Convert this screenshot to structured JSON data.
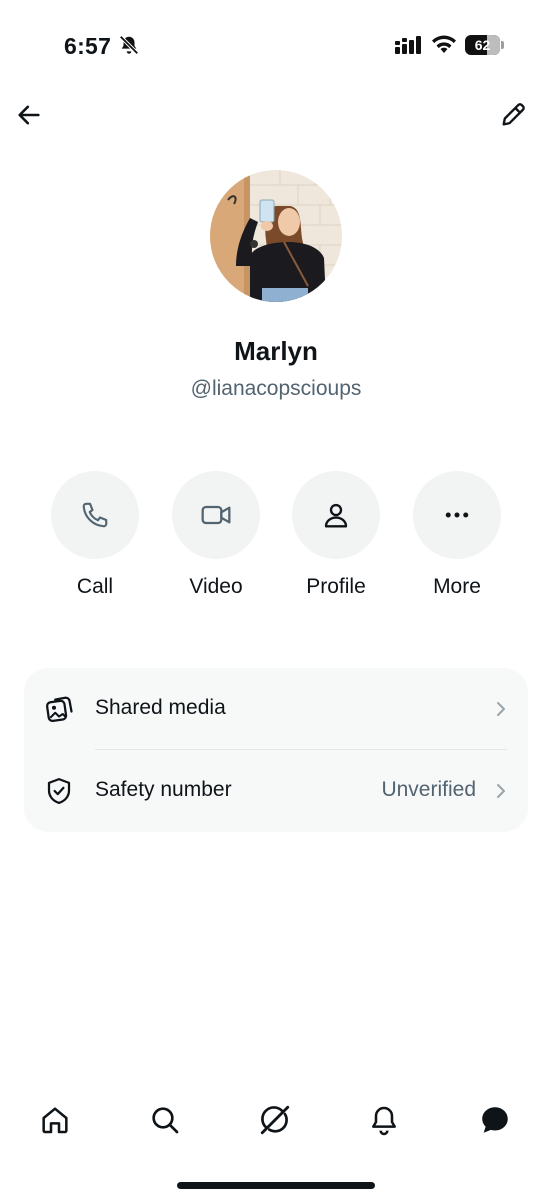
{
  "status_bar": {
    "time": "6:57",
    "battery_percent": "62",
    "battery_level": 0.62,
    "icons": [
      "bell-slash-icon",
      "signal-icon",
      "wifi-icon",
      "battery-icon"
    ]
  },
  "header": {
    "back_icon": "arrow-left-icon",
    "edit_icon": "pencil-icon"
  },
  "profile": {
    "display_name": "Marlyn",
    "handle": "@lianacopscioups"
  },
  "actions": [
    {
      "label": "Call",
      "icon": "phone-icon"
    },
    {
      "label": "Video",
      "icon": "video-camera-icon"
    },
    {
      "label": "Profile",
      "icon": "person-icon"
    },
    {
      "label": "More",
      "icon": "ellipsis-icon"
    }
  ],
  "settings": {
    "shared_media": {
      "label": "Shared media",
      "icon": "images-icon"
    },
    "safety_number": {
      "label": "Safety number",
      "value": "Unverified",
      "icon": "shield-check-icon"
    }
  },
  "bottom_nav": [
    {
      "name": "home",
      "icon": "home-icon"
    },
    {
      "name": "search",
      "icon": "search-icon"
    },
    {
      "name": "grok",
      "icon": "grok-icon"
    },
    {
      "name": "notifications",
      "icon": "bell-icon"
    },
    {
      "name": "messages",
      "icon": "message-bubble-icon",
      "active": true
    }
  ],
  "colors": {
    "text_primary": "#0f1419",
    "text_secondary": "#536471",
    "circle_bg": "#f2f3f3",
    "card_bg": "#f7f8f8"
  }
}
